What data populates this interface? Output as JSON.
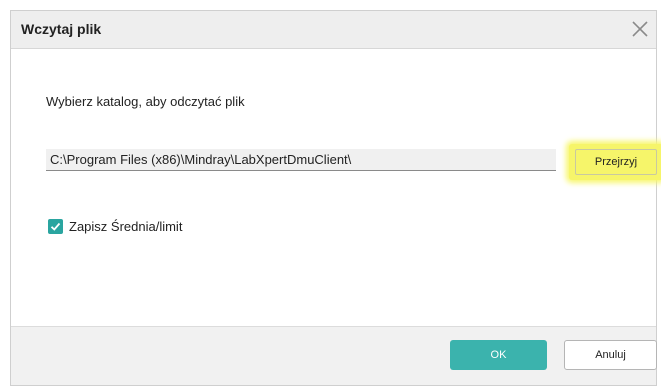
{
  "dialog": {
    "title": "Wczytaj plik",
    "close_icon": "close-icon"
  },
  "body": {
    "prompt": "Wybierz katalog, aby odczytać plik",
    "path_value": "C:\\Program Files (x86)\\Mindray\\LabXpertDmuClient\\",
    "browse_label": "Przejrzyj",
    "checkbox": {
      "label": "Zapisz Średnia/limit",
      "checked": true,
      "icon": "check-icon"
    }
  },
  "footer": {
    "ok_label": "OK",
    "cancel_label": "Anuluj"
  },
  "colors": {
    "accent": "#3bb3ad",
    "checkbox": "#2aa5a0",
    "highlight": "#f6f56a"
  }
}
